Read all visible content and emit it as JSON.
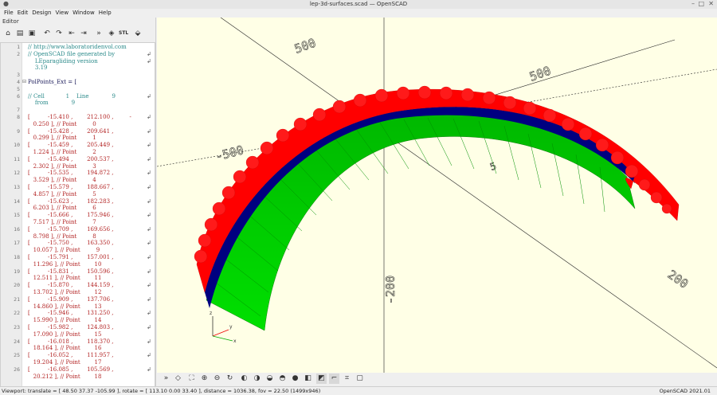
{
  "window": {
    "title": "lep-3d-surfaces.scad — OpenSCAD",
    "version": "OpenSCAD 2021.01"
  },
  "menu": [
    "File",
    "Edit",
    "Design",
    "View",
    "Window",
    "Help"
  ],
  "editor": {
    "label": "Editor",
    "toolbar": [
      "new-icon",
      "open-icon",
      "save-icon",
      "undo-icon",
      "redo-icon",
      "unindent-icon",
      "indent-icon",
      "preview-icon",
      "render-icon",
      "export-stl-icon",
      "send-print-icon"
    ],
    "toolbar_text": {
      "stl": "STL"
    },
    "line_numbers": [
      "1",
      "2",
      "",
      "",
      "3",
      "4",
      "5",
      "6",
      "",
      "7",
      "8",
      "",
      "9",
      "",
      "10",
      "",
      "11",
      "",
      "12",
      "",
      "13",
      "",
      "14",
      "",
      "15",
      "",
      "16",
      "",
      "17",
      "",
      "18",
      "",
      "19",
      "",
      "20",
      "",
      "21",
      "",
      "22",
      "",
      "23",
      "",
      "24",
      "",
      "25",
      "",
      "26"
    ],
    "lines": [
      {
        "t": "// http://www.laboratoridenvol.com",
        "k": "c"
      },
      {
        "t": "// OpenSCAD file generated by",
        "k": "c"
      },
      {
        "t": "    LEparagliding version",
        "k": "c"
      },
      {
        "t": "    3.19",
        "k": "c"
      },
      {
        "t": "",
        "k": "c"
      },
      {
        "t": "PolPoints_Ext = [",
        "k": "k"
      },
      {
        "t": "",
        "k": "c"
      },
      {
        "t": "// Cell            1    Line             9",
        "k": "c"
      },
      {
        "t": "    from             9",
        "k": "c"
      },
      {
        "t": "",
        "k": "c"
      },
      {
        "t": "[          -15.410 ,        212.100 ,         -",
        "k": "v"
      },
      {
        "t": "   0.250 ], // Point         0",
        "k": "v"
      },
      {
        "t": "[          -15.428 ,        209.641 ,",
        "k": "v"
      },
      {
        "t": "   0.299 ], // Point         1",
        "k": "v"
      },
      {
        "t": "[          -15.459 ,        205.449 ,",
        "k": "v"
      },
      {
        "t": "   1.224 ], // Point         2",
        "k": "v"
      },
      {
        "t": "[          -15.494 ,        200.537 ,",
        "k": "v"
      },
      {
        "t": "   2.302 ], // Point         3",
        "k": "v"
      },
      {
        "t": "[          -15.535 ,        194.872 ,",
        "k": "v"
      },
      {
        "t": "   3.529 ], // Point         4",
        "k": "v"
      },
      {
        "t": "[          -15.579 ,        188.667 ,",
        "k": "v"
      },
      {
        "t": "   4.857 ], // Point         5",
        "k": "v"
      },
      {
        "t": "[          -15.623 ,        182.283 ,",
        "k": "v"
      },
      {
        "t": "   6.203 ], // Point         6",
        "k": "v"
      },
      {
        "t": "[          -15.666 ,        175.946 ,",
        "k": "v"
      },
      {
        "t": "   7.517 ], // Point         7",
        "k": "v"
      },
      {
        "t": "[          -15.709 ,        169.656 ,",
        "k": "v"
      },
      {
        "t": "   8.798 ], // Point         8",
        "k": "v"
      },
      {
        "t": "[          -15.750 ,        163.350 ,",
        "k": "v"
      },
      {
        "t": "   10.057 ], // Point         9",
        "k": "v"
      },
      {
        "t": "[          -15.791 ,        157.001 ,",
        "k": "v"
      },
      {
        "t": "   11.296 ], // Point        10",
        "k": "v"
      },
      {
        "t": "[          -15.831 ,        150.596 ,",
        "k": "v"
      },
      {
        "t": "   12.511 ], // Point        11",
        "k": "v"
      },
      {
        "t": "[          -15.870 ,        144.159 ,",
        "k": "v"
      },
      {
        "t": "   13.702 ], // Point        12",
        "k": "v"
      },
      {
        "t": "[          -15.909 ,        137.706 ,",
        "k": "v"
      },
      {
        "t": "   14.860 ], // Point        13",
        "k": "v"
      },
      {
        "t": "[          -15.946 ,        131.250 ,",
        "k": "v"
      },
      {
        "t": "   15.990 ], // Point        14",
        "k": "v"
      },
      {
        "t": "[          -15.982 ,        124.803 ,",
        "k": "v"
      },
      {
        "t": "   17.090 ], // Point        15",
        "k": "v"
      },
      {
        "t": "[          -16.018 ,        118.370 ,",
        "k": "v"
      },
      {
        "t": "   18.164 ], // Point        16",
        "k": "v"
      },
      {
        "t": "[          -16.052 ,        111.957 ,",
        "k": "v"
      },
      {
        "t": "   19.204 ], // Point        17",
        "k": "v"
      },
      {
        "t": "[          -16.085 ,        105.569 ,",
        "k": "v"
      },
      {
        "t": "   20.212 ], // Point        18",
        "k": "v"
      }
    ]
  },
  "viewport": {
    "background": "#ffffe6",
    "axis_labels": [
      "500",
      "-500",
      "500",
      "-200",
      "200"
    ],
    "axes_indicator": [
      "x",
      "y",
      "z"
    ],
    "upper_color": "#ff0000",
    "lower_color": "#00cc00",
    "edge_color": "#000080"
  },
  "view_toolbar": [
    "reset-view-icon",
    "view-all-icon",
    "zoom-in-icon",
    "zoom-out-icon",
    "reset-rotation-icon",
    "view-right-icon",
    "view-top-icon",
    "view-bottom-icon",
    "view-left-icon",
    "view-front-icon",
    "view-back-icon",
    "perspective-icon",
    "orthogonal-icon",
    "show-axes-icon",
    "show-scale-icon",
    "show-edges-icon"
  ],
  "status": {
    "left": "Viewport: translate = [ 48.50 37.37 -105.99 ], rotate = [ 113.10 0.00 33.40 ], distance = 1036.38, fov = 22.50 (1499x946)",
    "right": "OpenSCAD 2021.01"
  }
}
